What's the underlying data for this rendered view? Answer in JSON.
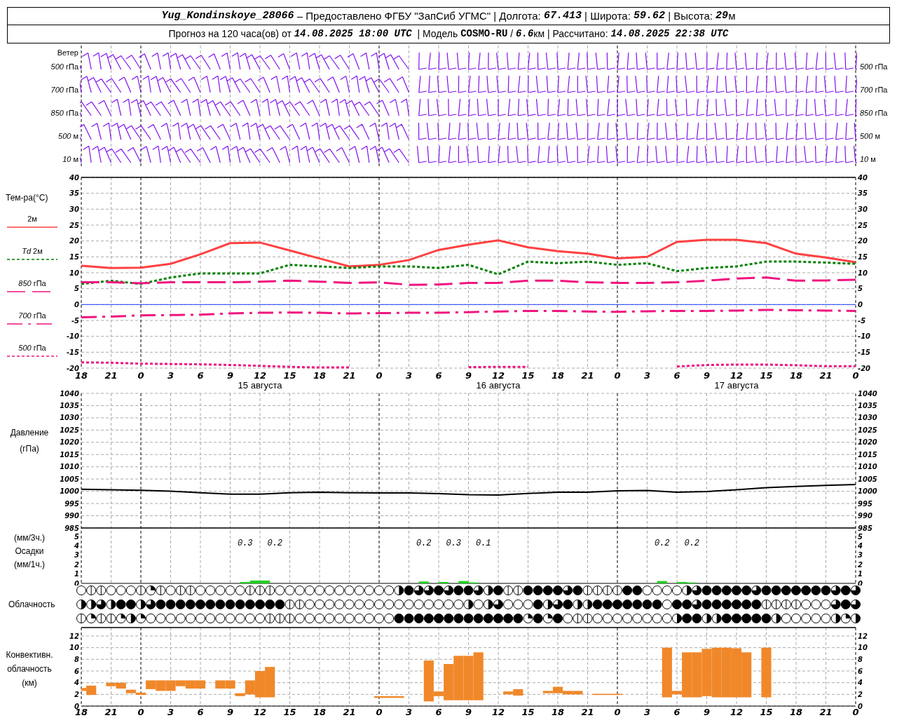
{
  "header": {
    "line1": [
      {
        "text": "Yug_Kondinskoye_28066",
        "kind": "italic"
      },
      {
        "text": " – Предоставлено ФГБУ \"ЗапСиб УГМС\" | Долгота: ",
        "kind": "plain"
      },
      {
        "text": "67.413",
        "kind": "italic"
      },
      {
        "text": " | Широта: ",
        "kind": "plain"
      },
      {
        "text": "59.62",
        "kind": "italic"
      },
      {
        "text": " | Высота: ",
        "kind": "plain"
      },
      {
        "text": "29",
        "kind": "italic"
      },
      {
        "text": "м",
        "kind": "plain"
      }
    ],
    "line2": [
      {
        "text": "Прогноз на 120 часа(ов) от ",
        "kind": "plain"
      },
      {
        "text": "14.08.2025 18:00 UTC",
        "kind": "italic"
      },
      {
        "text": "  | Модель ",
        "kind": "plain"
      },
      {
        "text": "COSMO-RU",
        "kind": "bold"
      },
      {
        "text": " / ",
        "kind": "plain"
      },
      {
        "text": "6.6",
        "kind": "italic"
      },
      {
        "text": "км | Рассчитано: ",
        "kind": "plain"
      },
      {
        "text": "14.08.2025 22:38 UTC",
        "kind": "italic"
      }
    ]
  },
  "wind": {
    "title": "Ветер",
    "levels": [
      {
        "left": "*500* гПа",
        "right": "*500* гПа"
      },
      {
        "left": "*700* гПа",
        "right": "*700* гПа"
      },
      {
        "left": "*850* гПа",
        "right": "*850* гПа"
      },
      {
        "left": "*500* м",
        "right": "*500* м"
      },
      {
        "left": "*10* м",
        "right": "*10* м"
      }
    ]
  },
  "temperature": {
    "title": "Тем-ра(°C)",
    "dates": [
      "15 августа",
      "16 августа",
      "17 августа"
    ],
    "right_ticks": [
      "40",
      "35",
      "30",
      "25",
      "20",
      "15",
      "10",
      "5",
      "0",
      "-5",
      "-10",
      "-15",
      "-20"
    ],
    "chart_data": {
      "type": "line",
      "grid": true,
      "categories": [
        "18",
        "21",
        "0",
        "3",
        "6",
        "9",
        "12",
        "15",
        "18",
        "21",
        "0",
        "3",
        "6",
        "9",
        "12",
        "15",
        "18",
        "21",
        "0",
        "3",
        "6",
        "9",
        "12",
        "15",
        "18",
        "21",
        "0"
      ],
      "ylim": [
        -20,
        40
      ],
      "yticks": [
        40,
        35,
        30,
        25,
        20,
        15,
        10,
        5,
        0,
        -5,
        -10,
        -15,
        -20
      ],
      "ref_lines": [
        {
          "axis": "y",
          "value": 0,
          "color": "#2040ff"
        }
      ],
      "series": [
        {
          "name": "2м",
          "line_style": "solid",
          "color": "#ff4040",
          "values": [
            12.2,
            11.5,
            11.6,
            12.8,
            15.8,
            19.3,
            19.5,
            17.0,
            14.5,
            12.0,
            12.5,
            14.0,
            17.2,
            18.8,
            20.2,
            18.0,
            16.8,
            16.0,
            14.5,
            15.0,
            19.7,
            20.4,
            20.4,
            19.3,
            16.0,
            14.8,
            13.3
          ]
        },
        {
          "name": "*Td*  2м",
          "line_style": "dotted",
          "color": "#008000",
          "values": [
            6.5,
            7.5,
            6.5,
            8.5,
            9.8,
            9.8,
            9.8,
            12.5,
            12.0,
            11.5,
            12.0,
            12.0,
            11.5,
            12.5,
            9.5,
            13.5,
            13.0,
            13.5,
            12.5,
            13.0,
            10.5,
            11.5,
            12.0,
            13.5,
            13.5,
            13.2,
            12.8
          ]
        },
        {
          "name": "*850*  гПа",
          "line_style": "dashed",
          "color": "#f0157f",
          "values": [
            7.0,
            7.0,
            6.7,
            7.0,
            7.0,
            7.0,
            7.2,
            7.5,
            7.2,
            6.8,
            7.0,
            6.2,
            6.3,
            6.8,
            6.8,
            7.5,
            7.5,
            7.0,
            6.8,
            6.8,
            7.0,
            7.5,
            8.2,
            8.5,
            7.5,
            7.6,
            7.8
          ]
        },
        {
          "name": "*700*  гПа",
          "line_style": "dashdot",
          "color": "#f0157f",
          "values": [
            -4.0,
            -3.8,
            -3.4,
            -3.3,
            -3.2,
            -2.8,
            -2.6,
            -2.5,
            -2.6,
            -2.8,
            -2.7,
            -2.6,
            -2.6,
            -2.4,
            -2.2,
            -2.0,
            -2.0,
            -2.2,
            -2.3,
            -2.1,
            -2.0,
            -2.0,
            -1.9,
            -1.7,
            -1.8,
            -1.9,
            -2.0
          ]
        },
        {
          "name": "*500*  гПа",
          "line_style": "dotted",
          "color": "#f0157f",
          "values": [
            -18.2,
            -18.3,
            -18.6,
            -18.7,
            -18.8,
            -19.0,
            -19.3,
            -19.6,
            -19.8,
            -19.8,
            null,
            null,
            null,
            -19.7,
            -19.6,
            -19.6,
            null,
            null,
            null,
            null,
            -19.5,
            -19.0,
            -18.9,
            -18.9,
            -19.1,
            -19.4,
            -19.4
          ]
        }
      ]
    }
  },
  "pressure": {
    "labels": [
      "Давление",
      "(гПа)"
    ],
    "right_ticks": [
      "1040",
      "1035",
      "1030",
      "1025",
      "1020",
      "1015",
      "1010",
      "1005",
      "1000",
      "995",
      "990",
      "985"
    ],
    "chart_data": {
      "type": "line",
      "grid": true,
      "categories": [
        null,
        null,
        null,
        null,
        null,
        null,
        null,
        null,
        null,
        null,
        null,
        null,
        null,
        null,
        null,
        null,
        null,
        null,
        null,
        null,
        null,
        null,
        null,
        null,
        null,
        null,
        null
      ],
      "ylim": [
        985,
        1040
      ],
      "yticks": [
        1040,
        1035,
        1030,
        1025,
        1020,
        1015,
        1010,
        1005,
        1000,
        995,
        990,
        985
      ],
      "series": [
        {
          "color": "#000000",
          "values": [
            1000.8,
            1000.6,
            1000.4,
            1000.0,
            999.4,
            998.8,
            998.8,
            999.4,
            999.6,
            999.4,
            999.3,
            999.3,
            999.0,
            998.6,
            998.5,
            999.1,
            999.6,
            999.6,
            1000.2,
            1000.3,
            999.6,
            999.9,
            1000.6,
            1001.5,
            1002.0,
            1002.4,
            1002.8
          ]
        }
      ]
    }
  },
  "precipitation": {
    "labels": [
      "(мм/3ч.)",
      "Осадки",
      "(мм/1ч.)"
    ],
    "right_ticks": [
      "5",
      "4",
      "3",
      "2",
      "1",
      "0"
    ],
    "periods": [
      {
        "kind": "dry"
      },
      {
        "kind": "dry"
      },
      {
        "kind": "dry"
      },
      {
        "kind": "dry"
      },
      {
        "kind": "dry"
      },
      {
        "kind": "wet",
        "total": "0.3"
      },
      {
        "kind": "wet",
        "total": "0.2"
      },
      {
        "kind": "dry"
      },
      {
        "kind": "dry"
      },
      {
        "kind": "dry"
      },
      {
        "kind": "dry"
      },
      {
        "kind": "wet",
        "total": "0.2"
      },
      {
        "kind": "wet",
        "total": "0.3"
      },
      {
        "kind": "wet",
        "total": "0.1"
      },
      {
        "kind": "dry"
      },
      {
        "kind": "dry"
      },
      {
        "kind": "dry"
      },
      {
        "kind": "dry"
      },
      {
        "kind": "dry"
      },
      {
        "kind": "wet",
        "total": "0.2"
      },
      {
        "kind": "wet",
        "total": "0.2"
      },
      {
        "kind": "dry"
      },
      {
        "kind": "dry"
      },
      {
        "kind": "dry"
      },
      {
        "kind": "dry"
      },
      {
        "kind": "dry"
      }
    ],
    "chart_data": {
      "type": "bar",
      "grid": true,
      "ylim": [
        0,
        5
      ],
      "yticks": [
        5,
        4,
        3,
        2,
        1,
        0
      ],
      "categories": [
        null,
        null,
        null,
        null,
        null,
        null,
        null,
        null,
        null,
        null,
        null,
        null,
        null,
        null,
        null,
        null,
        null,
        null,
        null,
        null,
        null,
        null,
        null,
        null,
        null,
        null,
        null,
        null,
        null,
        null,
        null,
        null,
        null,
        null,
        null,
        null,
        null,
        null,
        null,
        null,
        null,
        null,
        null,
        null,
        null,
        null,
        null,
        null,
        null,
        null,
        null,
        null,
        null,
        null,
        null,
        null,
        null,
        null,
        null,
        null,
        null,
        null,
        null,
        null,
        null,
        null,
        null,
        null,
        null,
        null,
        null,
        null,
        null,
        null,
        null,
        null,
        null,
        null
      ],
      "values": [
        0,
        0,
        0,
        0,
        0,
        0,
        0,
        0,
        0,
        0,
        0,
        0,
        0,
        0,
        0,
        0,
        0.15,
        0.3,
        0.3,
        0,
        0,
        0,
        0,
        0,
        0,
        0,
        0,
        0,
        0,
        0,
        0,
        0,
        0,
        0,
        0.2,
        0,
        0.15,
        0,
        0.25,
        0.1,
        0,
        0,
        0,
        0,
        0,
        0,
        0,
        0,
        0,
        0,
        0,
        0,
        0,
        0,
        0,
        0,
        0,
        0,
        0.25,
        0,
        0.15,
        0.1,
        0,
        0,
        0,
        0,
        0,
        0,
        0,
        0,
        0,
        0,
        0,
        0,
        0,
        0,
        0,
        0
      ]
    }
  },
  "cloudiness": {
    "label": "Облачность",
    "rows": [
      {
        "symbols": [
          {
            "kind": "clear"
          },
          {
            "kind": "few"
          },
          {
            "kind": "few"
          },
          {
            "kind": "clear"
          },
          {
            "kind": "clear"
          },
          {
            "kind": "clear"
          },
          {
            "kind": "few"
          },
          {
            "kind": "quarter"
          },
          {
            "kind": "few"
          },
          {
            "kind": "clear"
          },
          {
            "kind": "few"
          },
          {
            "kind": "few"
          },
          {
            "kind": "clear"
          },
          {
            "kind": "clear"
          },
          {
            "kind": "clear"
          },
          {
            "kind": "clear"
          },
          {
            "kind": "clear"
          },
          {
            "kind": "few"
          },
          {
            "kind": "few"
          },
          {
            "kind": "few"
          },
          {
            "kind": "clear"
          },
          {
            "kind": "clear"
          },
          {
            "kind": "clear"
          },
          {
            "kind": "clear"
          },
          {
            "kind": "clear"
          },
          {
            "kind": "clear"
          },
          {
            "kind": "clear"
          },
          {
            "kind": "clear"
          },
          {
            "kind": "clear"
          },
          {
            "kind": "clear"
          },
          {
            "kind": "clear"
          },
          {
            "kind": "clear"
          },
          {
            "kind": "half"
          },
          {
            "kind": "overcast"
          },
          {
            "kind": "most"
          },
          {
            "kind": "most"
          },
          {
            "kind": "overcast"
          },
          {
            "kind": "most"
          },
          {
            "kind": "overcast"
          },
          {
            "kind": "overcast"
          },
          {
            "kind": "most"
          },
          {
            "kind": "half"
          },
          {
            "kind": "overcast"
          },
          {
            "kind": "few"
          },
          {
            "kind": "few"
          },
          {
            "kind": "overcast"
          },
          {
            "kind": "overcast"
          },
          {
            "kind": "overcast"
          },
          {
            "kind": "overcast"
          },
          {
            "kind": "most"
          },
          {
            "kind": "overcast"
          },
          {
            "kind": "few"
          },
          {
            "kind": "few"
          },
          {
            "kind": "few"
          },
          {
            "kind": "few"
          },
          {
            "kind": "overcast"
          },
          {
            "kind": "overcast"
          },
          {
            "kind": "clear"
          },
          {
            "kind": "clear"
          },
          {
            "kind": "clear"
          },
          {
            "kind": "clear"
          },
          {
            "kind": "half"
          },
          {
            "kind": "most"
          },
          {
            "kind": "overcast"
          },
          {
            "kind": "overcast"
          },
          {
            "kind": "overcast"
          },
          {
            "kind": "overcast"
          },
          {
            "kind": "overcast"
          },
          {
            "kind": "most"
          },
          {
            "kind": "overcast"
          },
          {
            "kind": "overcast"
          },
          {
            "kind": "overcast"
          },
          {
            "kind": "overcast"
          },
          {
            "kind": "overcast"
          },
          {
            "kind": "overcast"
          },
          {
            "kind": "overcast"
          },
          {
            "kind": "most"
          },
          {
            "kind": "overcast"
          },
          {
            "kind": "most"
          }
        ]
      },
      {
        "symbols": [
          {
            "kind": "half"
          },
          {
            "kind": "half"
          },
          {
            "kind": "most"
          },
          {
            "kind": "half"
          },
          {
            "kind": "overcast"
          },
          {
            "kind": "overcast"
          },
          {
            "kind": "half"
          },
          {
            "kind": "most"
          },
          {
            "kind": "overcast"
          },
          {
            "kind": "overcast"
          },
          {
            "kind": "overcast"
          },
          {
            "kind": "overcast"
          },
          {
            "kind": "overcast"
          },
          {
            "kind": "overcast"
          },
          {
            "kind": "overcast"
          },
          {
            "kind": "overcast"
          },
          {
            "kind": "overcast"
          },
          {
            "kind": "overcast"
          },
          {
            "kind": "overcast"
          },
          {
            "kind": "overcast"
          },
          {
            "kind": "overcast"
          },
          {
            "kind": "few"
          },
          {
            "kind": "few"
          },
          {
            "kind": "clear"
          },
          {
            "kind": "clear"
          },
          {
            "kind": "clear"
          },
          {
            "kind": "clear"
          },
          {
            "kind": "clear"
          },
          {
            "kind": "clear"
          },
          {
            "kind": "clear"
          },
          {
            "kind": "clear"
          },
          {
            "kind": "clear"
          },
          {
            "kind": "clear"
          },
          {
            "kind": "clear"
          },
          {
            "kind": "clear"
          },
          {
            "kind": "clear"
          },
          {
            "kind": "clear"
          },
          {
            "kind": "clear"
          },
          {
            "kind": "clear"
          },
          {
            "kind": "half"
          },
          {
            "kind": "clear"
          },
          {
            "kind": "half"
          },
          {
            "kind": "most"
          },
          {
            "kind": "clear"
          },
          {
            "kind": "clear"
          },
          {
            "kind": "clear"
          },
          {
            "kind": "overcast"
          },
          {
            "kind": "half"
          },
          {
            "kind": "most"
          },
          {
            "kind": "overcast"
          },
          {
            "kind": "half"
          },
          {
            "kind": "half"
          },
          {
            "kind": "overcast"
          },
          {
            "kind": "overcast"
          },
          {
            "kind": "overcast"
          },
          {
            "kind": "overcast"
          },
          {
            "kind": "overcast"
          },
          {
            "kind": "overcast"
          },
          {
            "kind": "overcast"
          },
          {
            "kind": "clear"
          },
          {
            "kind": "overcast"
          },
          {
            "kind": "overcast"
          },
          {
            "kind": "most"
          },
          {
            "kind": "overcast"
          },
          {
            "kind": "overcast"
          },
          {
            "kind": "overcast"
          },
          {
            "kind": "overcast"
          },
          {
            "kind": "overcast"
          },
          {
            "kind": "overcast"
          },
          {
            "kind": "few"
          },
          {
            "kind": "few"
          },
          {
            "kind": "few"
          },
          {
            "kind": "few"
          },
          {
            "kind": "clear"
          },
          {
            "kind": "clear"
          },
          {
            "kind": "clear"
          },
          {
            "kind": "most"
          },
          {
            "kind": "overcast"
          },
          {
            "kind": "most"
          }
        ]
      },
      {
        "symbols": [
          {
            "kind": "few"
          },
          {
            "kind": "quarter"
          },
          {
            "kind": "few"
          },
          {
            "kind": "few"
          },
          {
            "kind": "quarter"
          },
          {
            "kind": "half"
          },
          {
            "kind": "quarter"
          },
          {
            "kind": "clear"
          },
          {
            "kind": "clear"
          },
          {
            "kind": "clear"
          },
          {
            "kind": "clear"
          },
          {
            "kind": "clear"
          },
          {
            "kind": "clear"
          },
          {
            "kind": "clear"
          },
          {
            "kind": "clear"
          },
          {
            "kind": "clear"
          },
          {
            "kind": "clear"
          },
          {
            "kind": "clear"
          },
          {
            "kind": "clear"
          },
          {
            "kind": "few"
          },
          {
            "kind": "few"
          },
          {
            "kind": "few"
          },
          {
            "kind": "clear"
          },
          {
            "kind": "clear"
          },
          {
            "kind": "clear"
          },
          {
            "kind": "clear"
          },
          {
            "kind": "clear"
          },
          {
            "kind": "clear"
          },
          {
            "kind": "clear"
          },
          {
            "kind": "clear"
          },
          {
            "kind": "clear"
          },
          {
            "kind": "clear"
          },
          {
            "kind": "overcast"
          },
          {
            "kind": "overcast"
          },
          {
            "kind": "overcast"
          },
          {
            "kind": "overcast"
          },
          {
            "kind": "overcast"
          },
          {
            "kind": "overcast"
          },
          {
            "kind": "overcast"
          },
          {
            "kind": "overcast"
          },
          {
            "kind": "overcast"
          },
          {
            "kind": "overcast"
          },
          {
            "kind": "overcast"
          },
          {
            "kind": "overcast"
          },
          {
            "kind": "overcast"
          },
          {
            "kind": "quarter"
          },
          {
            "kind": "overcast"
          },
          {
            "kind": "quarter"
          },
          {
            "kind": "overcast"
          },
          {
            "kind": "clear"
          },
          {
            "kind": "few"
          },
          {
            "kind": "few"
          },
          {
            "kind": "clear"
          },
          {
            "kind": "clear"
          },
          {
            "kind": "clear"
          },
          {
            "kind": "clear"
          },
          {
            "kind": "clear"
          },
          {
            "kind": "clear"
          },
          {
            "kind": "clear"
          },
          {
            "kind": "clear"
          },
          {
            "kind": "half"
          },
          {
            "kind": "overcast"
          },
          {
            "kind": "overcast"
          },
          {
            "kind": "half"
          },
          {
            "kind": "half"
          },
          {
            "kind": "overcast"
          },
          {
            "kind": "overcast"
          },
          {
            "kind": "overcast"
          },
          {
            "kind": "overcast"
          },
          {
            "kind": "overcast"
          },
          {
            "kind": "half"
          },
          {
            "kind": "clear"
          },
          {
            "kind": "clear"
          },
          {
            "kind": "clear"
          },
          {
            "kind": "clear"
          },
          {
            "kind": "clear"
          },
          {
            "kind": "half"
          },
          {
            "kind": "quarter"
          },
          {
            "kind": "half"
          }
        ]
      }
    ]
  },
  "convective": {
    "labels": [
      "Конвективн.",
      "облачность",
      "(км)"
    ],
    "right_ticks": [
      "12",
      "10",
      "8",
      "6",
      "4",
      "2",
      "0"
    ],
    "chart_data": {
      "type": "candlestick",
      "grid": true,
      "ylim": [
        0,
        13.44
      ],
      "yticks": [
        12,
        10,
        8,
        6,
        4,
        2,
        0
      ],
      "categories": [
        "18",
        null,
        null,
        "21",
        null,
        null,
        "0",
        null,
        null,
        "3",
        null,
        null,
        "6",
        null,
        null,
        "9",
        null,
        null,
        "12",
        null,
        null,
        "15",
        null,
        null,
        "18",
        null,
        null,
        "21",
        null,
        null,
        "0",
        null,
        null,
        "3",
        null,
        null,
        "6",
        null,
        null,
        "9",
        null,
        null,
        "12",
        null,
        null,
        "15",
        null,
        null,
        "18",
        null,
        null,
        "21",
        null,
        null,
        "0",
        null,
        null,
        "3",
        null,
        null,
        "6",
        null,
        null,
        "9",
        null,
        null,
        "12",
        null,
        null,
        "15",
        null,
        null,
        "18",
        null,
        null,
        "21",
        null,
        null,
        "0"
      ],
      "ohlc": [
        [
          2.6,
          3.1,
          2.6,
          3.1
        ],
        [
          1.9,
          3.5,
          1.9,
          3.5
        ],
        null,
        [
          3.4,
          4.0,
          3.4,
          4.0
        ],
        [
          3.0,
          4.0,
          3.0,
          4.0
        ],
        [
          2.2,
          2.8,
          2.2,
          2.8
        ],
        [
          1.9,
          2.3,
          1.9,
          2.3
        ],
        [
          2.9,
          4.4,
          2.9,
          4.4
        ],
        [
          2.6,
          4.4,
          2.6,
          4.4
        ],
        [
          2.6,
          4.4,
          2.6,
          4.4
        ],
        [
          3.4,
          4.4,
          3.4,
          4.4
        ],
        [
          3.0,
          4.4,
          3.0,
          4.4
        ],
        [
          3.0,
          4.4,
          3.0,
          4.4
        ],
        null,
        [
          3.0,
          4.4,
          3.0,
          4.4
        ],
        [
          3.0,
          4.4,
          3.0,
          4.4
        ],
        [
          1.7,
          2.2,
          1.7,
          2.2
        ],
        [
          2.0,
          4.4,
          2.0,
          4.4
        ],
        [
          1.5,
          6.0,
          1.5,
          6.0
        ],
        [
          1.5,
          6.7,
          1.5,
          6.7
        ],
        null,
        null,
        null,
        null,
        null,
        null,
        null,
        null,
        null,
        null,
        [
          1.4,
          1.7,
          1.4,
          1.7
        ],
        [
          1.4,
          1.7,
          1.4,
          1.7
        ],
        [
          1.4,
          1.7,
          1.4,
          1.7
        ],
        null,
        null,
        [
          0.8,
          7.8,
          0.8,
          7.8
        ],
        [
          1.7,
          2.5,
          1.7,
          2.5
        ],
        [
          1.0,
          7.2,
          1.0,
          7.2
        ],
        [
          1.0,
          8.6,
          1.0,
          8.6
        ],
        [
          1.0,
          8.6,
          1.0,
          8.6
        ],
        [
          1.0,
          9.2,
          1.0,
          9.2
        ],
        null,
        null,
        [
          2.0,
          2.5,
          2.0,
          2.5
        ],
        [
          1.8,
          2.9,
          1.8,
          2.9
        ],
        null,
        null,
        [
          2.2,
          2.6,
          2.2,
          2.6
        ],
        [
          2.2,
          3.3,
          2.2,
          3.3
        ],
        [
          2.0,
          2.6,
          2.0,
          2.6
        ],
        [
          2.0,
          2.6,
          2.0,
          2.6
        ],
        null,
        [
          1.9,
          2.1,
          1.9,
          2.1
        ],
        [
          1.9,
          2.1,
          1.9,
          2.1
        ],
        [
          1.9,
          2.1,
          1.9,
          2.1
        ],
        null,
        null,
        null,
        null,
        [
          1.5,
          10,
          1.5,
          10
        ],
        [
          2.0,
          2.6,
          2.0,
          2.6
        ],
        [
          1.5,
          9.2,
          1.5,
          9.2
        ],
        [
          1.5,
          9.2,
          1.5,
          9.2
        ],
        [
          1.7,
          9.8,
          1.7,
          9.8
        ],
        [
          1.5,
          10,
          1.5,
          10
        ],
        [
          1.5,
          10,
          1.5,
          10
        ],
        [
          1.5,
          9.9,
          1.5,
          9.9
        ],
        [
          1.5,
          9.2,
          1.5,
          9.2
        ],
        null,
        [
          1.5,
          10,
          1.5,
          10
        ],
        null,
        null,
        null,
        null,
        null,
        null,
        null,
        null,
        null
      ]
    }
  }
}
